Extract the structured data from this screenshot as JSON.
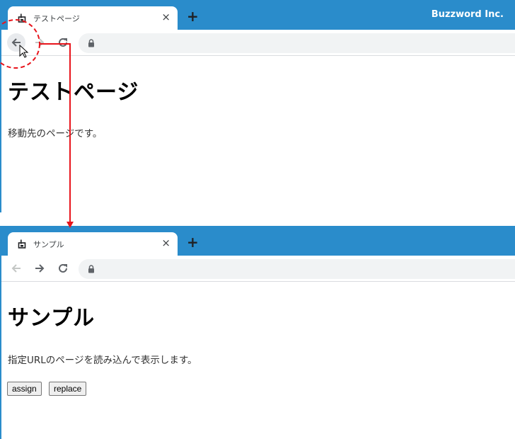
{
  "top_window": {
    "tab_title": "テストページ",
    "tab_close": "×",
    "new_tab": "+",
    "brand": "Buzzword Inc.",
    "heading": "テストページ",
    "paragraph": "移動先のページです。",
    "back_enabled": true,
    "forward_enabled": false
  },
  "bottom_window": {
    "tab_title": "サンプル",
    "tab_close": "×",
    "new_tab": "+",
    "heading": "サンプル",
    "paragraph": "指定URLのページを読み込んで表示します。",
    "buttons": [
      {
        "label": "assign"
      },
      {
        "label": "replace"
      }
    ],
    "back_enabled": false,
    "forward_enabled": true
  },
  "annotation": {
    "color": "#e8141b",
    "highlight": "back-button"
  },
  "colors": {
    "titlebar": "#2a8ccb",
    "omnibox": "#f1f3f4"
  }
}
